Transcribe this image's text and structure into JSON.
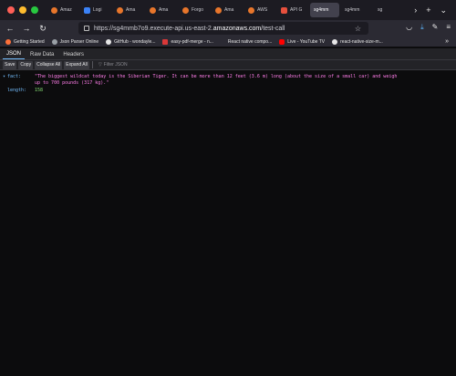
{
  "tabs": [
    {
      "label": "Amaz",
      "favicon": "amazon-icon",
      "active": false
    },
    {
      "label": "Logi",
      "favicon": "login-icon",
      "active": false
    },
    {
      "label": "Ama",
      "favicon": "amazon-icon",
      "active": false
    },
    {
      "label": "Ama",
      "favicon": "amazon-icon",
      "active": false
    },
    {
      "label": "Forgo",
      "favicon": "amazon-icon",
      "active": false
    },
    {
      "label": "Ama",
      "favicon": "amazon-icon",
      "active": false
    },
    {
      "label": "AWS",
      "favicon": "amazon-icon",
      "active": false
    },
    {
      "label": "API G",
      "favicon": "aws-icon",
      "active": false
    },
    {
      "label": "sg4mm",
      "favicon": "none",
      "active": true
    },
    {
      "label": "sg4mm",
      "favicon": "none",
      "active": false
    },
    {
      "label": "sg",
      "favicon": "none",
      "active": false
    }
  ],
  "url": {
    "prefix": "https://sg4mmb7o9.execute-api.us-east-2.",
    "domain": "amazonaws.com",
    "path": "/test-call"
  },
  "bookmarks": [
    {
      "label": "Getting Started",
      "icon": "firefox-icon"
    },
    {
      "label": "Json Parser Online",
      "icon": "globe-icon"
    },
    {
      "label": "GitHub - wondayle...",
      "icon": "github-icon"
    },
    {
      "label": "easy-pdf-merge - n...",
      "icon": "pdf-icon"
    },
    {
      "label": "React native compo...",
      "icon": "none"
    },
    {
      "label": "Live - YouTube TV",
      "icon": "youtube-icon"
    },
    {
      "label": "react-native-size-m...",
      "icon": "github-icon"
    }
  ],
  "viewer": {
    "tabs": [
      "JSON",
      "Raw Data",
      "Headers"
    ],
    "active_tab": "JSON",
    "toolbar": [
      "Save",
      "Copy",
      "Collapse All",
      "Expand All"
    ],
    "filter_placeholder": "Filter JSON"
  },
  "json": {
    "fact_key": "fact:",
    "fact_value": "\"The biggest wildcat today is the Siberian Tiger. It can be more than 12 feet (3.6 m) long (about the size of a small car) and weigh up to 700 pounds (317 kg).\"",
    "length_key": "length:",
    "length_value": "158"
  },
  "colors": {
    "key": "#75bfff",
    "string": "#ff7de9",
    "number": "#86de74"
  }
}
